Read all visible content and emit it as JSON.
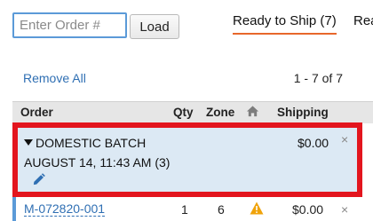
{
  "search": {
    "placeholder": "Enter Order #",
    "value": ""
  },
  "toolbar": {
    "load_label": "Load"
  },
  "tabs": [
    {
      "label": "Ready to Ship (7)",
      "active": true
    },
    {
      "label": "Read"
    }
  ],
  "list_controls": {
    "remove_all_label": "Remove All",
    "range_label": "1 - 7 of 7"
  },
  "table": {
    "columns": {
      "order": "Order",
      "qty": "Qty",
      "zone": "Zone",
      "shipping": "Shipping"
    },
    "home_icon": "home-icon"
  },
  "batch": {
    "title": "DOMESTIC BATCH",
    "date": "AUGUST 14, 11:43 AM (3)",
    "shipping": "$0.00",
    "close_glyph": "×",
    "edit_icon": "pencil-icon"
  },
  "orders": [
    {
      "id": "M-072820-001",
      "qty": "1",
      "zone": "6",
      "shipping": "$0.00",
      "warning_icon": "warning-icon",
      "close_glyph": "×"
    }
  ],
  "colors": {
    "active_tab_underline": "#e8672b",
    "link": "#2f6fb3",
    "highlight_border": "#e3151e",
    "batch_background": "#dce9f4",
    "warning": "#f0a30a"
  }
}
